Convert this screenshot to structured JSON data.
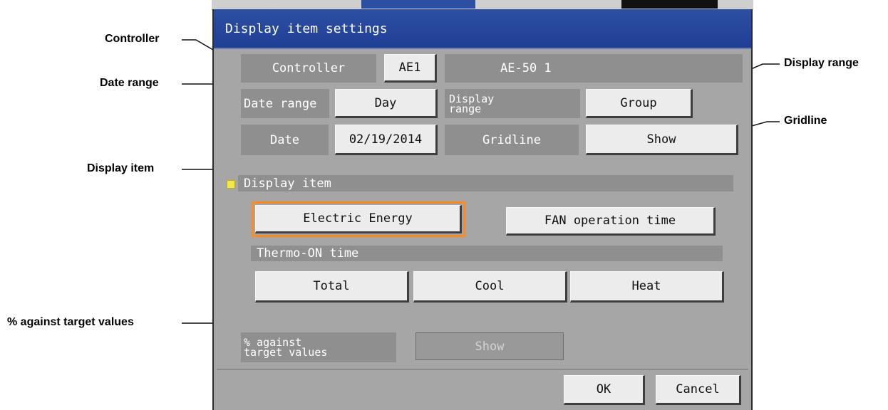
{
  "callouts": {
    "controller": "Controller",
    "date_range": "Date range",
    "display_item": "Display item",
    "target_values": "% against target values",
    "display_range": "Display range",
    "gridline": "Gridline"
  },
  "dialog": {
    "title": "Display item settings",
    "controller": {
      "label": "Controller",
      "button": "AE1",
      "value": "AE-50 1"
    },
    "date_range": {
      "label": "Date range",
      "button": "Day"
    },
    "display_range": {
      "label_line1": "Display",
      "label_line2": "range",
      "button": "Group"
    },
    "date": {
      "label": "Date",
      "button": "02/19/2014"
    },
    "gridline": {
      "label": "Gridline",
      "button": "Show"
    },
    "display_item": {
      "header": "Display item",
      "electric_energy": "Electric Energy",
      "fan_operation_time": "FAN operation time",
      "thermo_on_label": "Thermo-ON time",
      "total": "Total",
      "cool": "Cool",
      "heat": "Heat"
    },
    "target_values": {
      "label_line1": "% against",
      "label_line2": "target values",
      "button": "Show"
    },
    "ok": "OK",
    "cancel": "Cancel"
  },
  "colors": {
    "title_bar": "#2748a0",
    "selected_outline": "#ff8a1f",
    "section_marker": "#f3e84a"
  }
}
